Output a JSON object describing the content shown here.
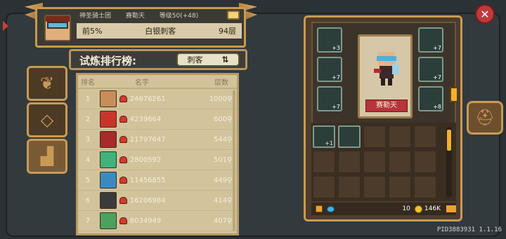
{
  "header": {
    "guild": "神圣骑士团",
    "player_name": "赛勒天",
    "level_text": "等级50(+48)",
    "rank_percent": "前5%",
    "class_title": "白银刺客",
    "floor": "94层"
  },
  "ranking": {
    "title": "试炼排行榜:",
    "class_filter": "刺客",
    "columns": {
      "rank": "排名",
      "name": "名字",
      "floor": "层数"
    },
    "rows": [
      {
        "rank": "1",
        "name": "24676261",
        "floor": "1000"
      },
      {
        "rank": "2",
        "name": "4239664",
        "floor": "600"
      },
      {
        "rank": "3",
        "name": "21797647",
        "floor": "544"
      },
      {
        "rank": "4",
        "name": "2800592",
        "floor": "501"
      },
      {
        "rank": "5",
        "name": "11456855",
        "floor": "449"
      },
      {
        "rank": "6",
        "name": "16206984",
        "floor": "414"
      },
      {
        "rank": "7",
        "name": "8034949",
        "floor": "407"
      }
    ]
  },
  "equipment": {
    "character_name": "赛勒天",
    "slot_levels": [
      "+3",
      "+7",
      "+7",
      "+7",
      "+7",
      "+8"
    ],
    "bag_levels": [
      "+1",
      ""
    ]
  },
  "currency": {
    "gems": "10",
    "coins": "146K"
  },
  "footer": {
    "pid": "PID3883931 1.1.16"
  },
  "colors": {
    "frame_gold": "#c99a55",
    "close_red": "#c0393b",
    "name_red": "#b8333a"
  }
}
